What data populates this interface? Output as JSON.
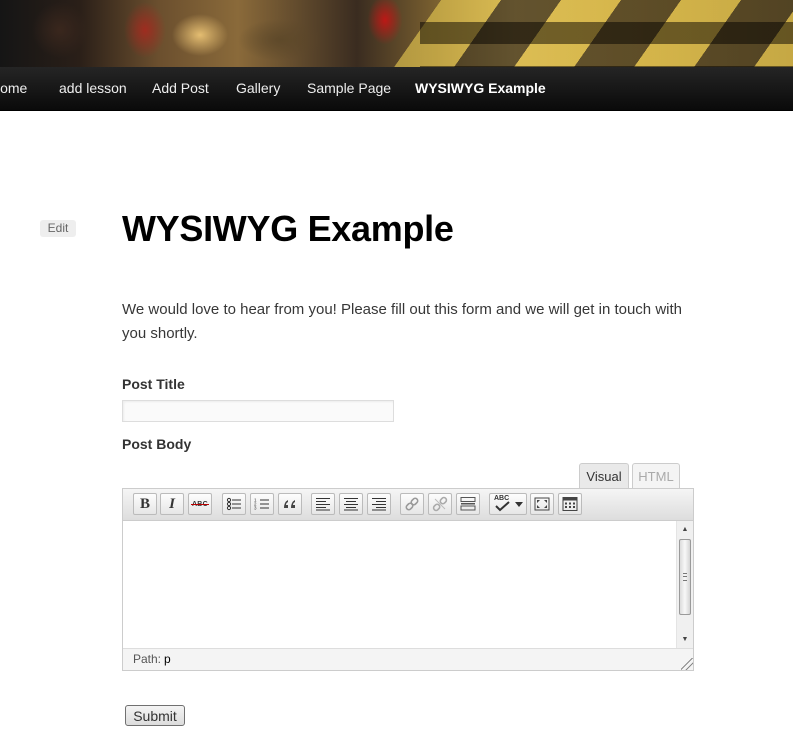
{
  "nav": {
    "items": [
      {
        "label": "Home"
      },
      {
        "label": "add lesson"
      },
      {
        "label": "Add Post"
      },
      {
        "label": "Gallery"
      },
      {
        "label": "Sample Page"
      },
      {
        "label": "WYSIWYG Example"
      }
    ],
    "current": "WYSIWYG Example"
  },
  "page": {
    "edit_link": "Edit",
    "title": "WYSIWYG Example",
    "intro": "We would love to hear from you! Please fill out this form and we will get in touch with you shortly."
  },
  "form": {
    "post_title_label": "Post Title",
    "post_title_value": "",
    "post_body_label": "Post Body",
    "submit_label": "Submit"
  },
  "editor": {
    "tabs": [
      {
        "label": "Visual",
        "active": true
      },
      {
        "label": "HTML",
        "active": false
      }
    ],
    "toolbar": [
      {
        "icon": "bold-icon",
        "glyph": "B"
      },
      {
        "icon": "italic-icon",
        "glyph": "I"
      },
      {
        "icon": "strikethrough-icon",
        "glyph": "ABC"
      },
      {
        "icon": "bulleted-list-icon"
      },
      {
        "icon": "numbered-list-icon"
      },
      {
        "icon": "blockquote-icon"
      },
      {
        "icon": "align-left-icon"
      },
      {
        "icon": "align-center-icon"
      },
      {
        "icon": "align-right-icon"
      },
      {
        "icon": "insert-link-icon"
      },
      {
        "icon": "unlink-icon"
      },
      {
        "icon": "more-tag-icon"
      },
      {
        "icon": "spellcheck-icon",
        "glyph": "ABC"
      },
      {
        "icon": "fullscreen-icon"
      },
      {
        "icon": "kitchen-sink-icon"
      }
    ],
    "content": "",
    "path_label": "Path:",
    "path_value": "p"
  },
  "colors": {
    "nav_background": "#111111",
    "nav_text": "#eeeeee",
    "title_text": "#000000",
    "body_text": "#373737",
    "tab_inactive_text": "#aaaaaa"
  }
}
